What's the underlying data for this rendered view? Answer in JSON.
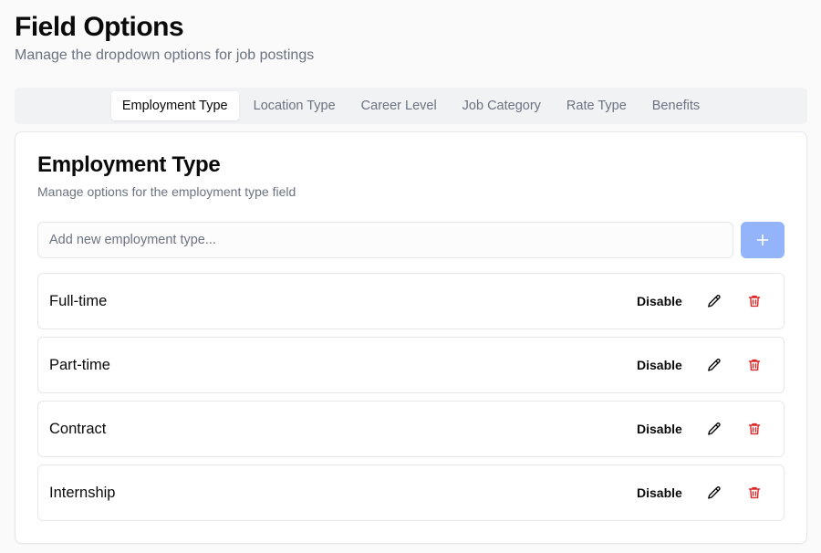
{
  "header": {
    "title": "Field Options",
    "subtitle": "Manage the dropdown options for job postings"
  },
  "tabs": [
    {
      "label": "Employment Type",
      "active": true
    },
    {
      "label": "Location Type",
      "active": false
    },
    {
      "label": "Career Level",
      "active": false
    },
    {
      "label": "Job Category",
      "active": false
    },
    {
      "label": "Rate Type",
      "active": false
    },
    {
      "label": "Benefits",
      "active": false
    }
  ],
  "card": {
    "title": "Employment Type",
    "subtitle": "Manage options for the employment type field",
    "add_input": {
      "value": "",
      "placeholder": "Add new employment type..."
    },
    "add_button_icon": "plus-icon",
    "options": [
      {
        "label": "Full-time",
        "action_label": "Disable"
      },
      {
        "label": "Part-time",
        "action_label": "Disable"
      },
      {
        "label": "Contract",
        "action_label": "Disable"
      },
      {
        "label": "Internship",
        "action_label": "Disable"
      }
    ]
  },
  "colors": {
    "accent_button": "#93b4f8",
    "delete_icon": "#dc2626",
    "muted_text": "#6b7280"
  }
}
